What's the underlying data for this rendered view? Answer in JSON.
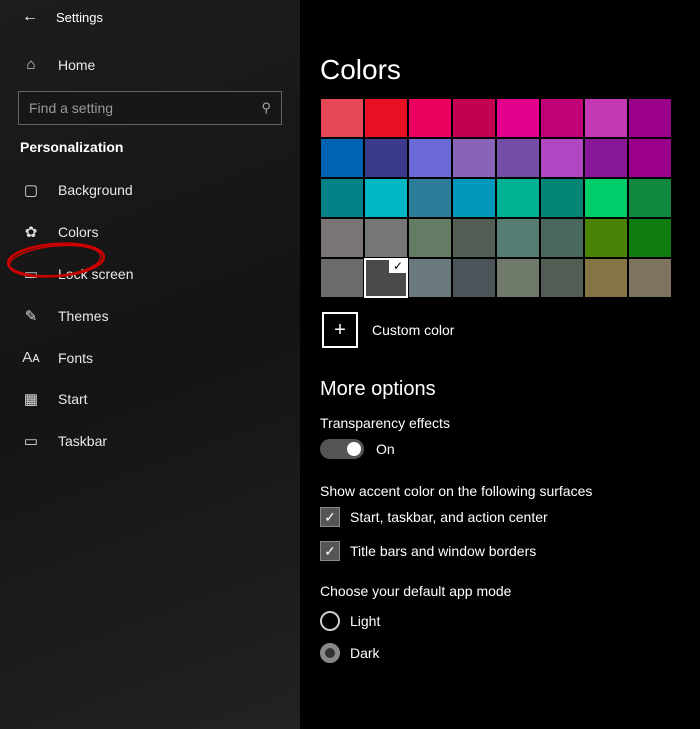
{
  "app_title": "Settings",
  "search_placeholder": "Find a setting",
  "home_label": "Home",
  "section_label": "Personalization",
  "nav": [
    {
      "icon": "▢",
      "label": "Background"
    },
    {
      "icon": "✿",
      "label": "Colors"
    },
    {
      "icon": "▭",
      "label": "Lock screen"
    },
    {
      "icon": "✎",
      "label": "Themes"
    },
    {
      "icon": "Aᴀ",
      "label": "Fonts"
    },
    {
      "icon": "▦",
      "label": "Start"
    },
    {
      "icon": "▭",
      "label": "Taskbar"
    }
  ],
  "page_title": "Colors",
  "swatches": [
    [
      "#e74856",
      "#e81123",
      "#ea005e",
      "#c30052",
      "#e3008c",
      "#bf0077",
      "#c239b3",
      "#9a0089"
    ],
    [
      "#0063b1",
      "#3b3a8b",
      "#6b69d6",
      "#8764b8",
      "#744da9",
      "#b146c2",
      "#881798",
      "#9a0089"
    ],
    [
      "#038387",
      "#00b7c3",
      "#2d7d9a",
      "#0099bc",
      "#00b294",
      "#018574",
      "#00cc6a",
      "#10893e"
    ],
    [
      "#7a7574",
      "#767676",
      "#647c64",
      "#525e54",
      "#567c73",
      "#486860",
      "#498205",
      "#107c10"
    ],
    [
      "#6b6b6b",
      "#4c4a48",
      "#69797e",
      "#4a5459",
      "#6f7a6b",
      "#525e54",
      "#847545",
      "#7e735f"
    ]
  ],
  "selected_swatch": {
    "row": 4,
    "col": 1
  },
  "custom_color_label": "Custom color",
  "more_options_title": "More options",
  "transparency_label": "Transparency effects",
  "toggle_state": "On",
  "accent_surfaces_label": "Show accent color on the following surfaces",
  "cb_start_label": "Start, taskbar, and action center",
  "cb_title_label": "Title bars and window borders",
  "app_mode_label": "Choose your default app mode",
  "radio_light": "Light",
  "radio_dark": "Dark",
  "app_mode_selected": "Dark"
}
